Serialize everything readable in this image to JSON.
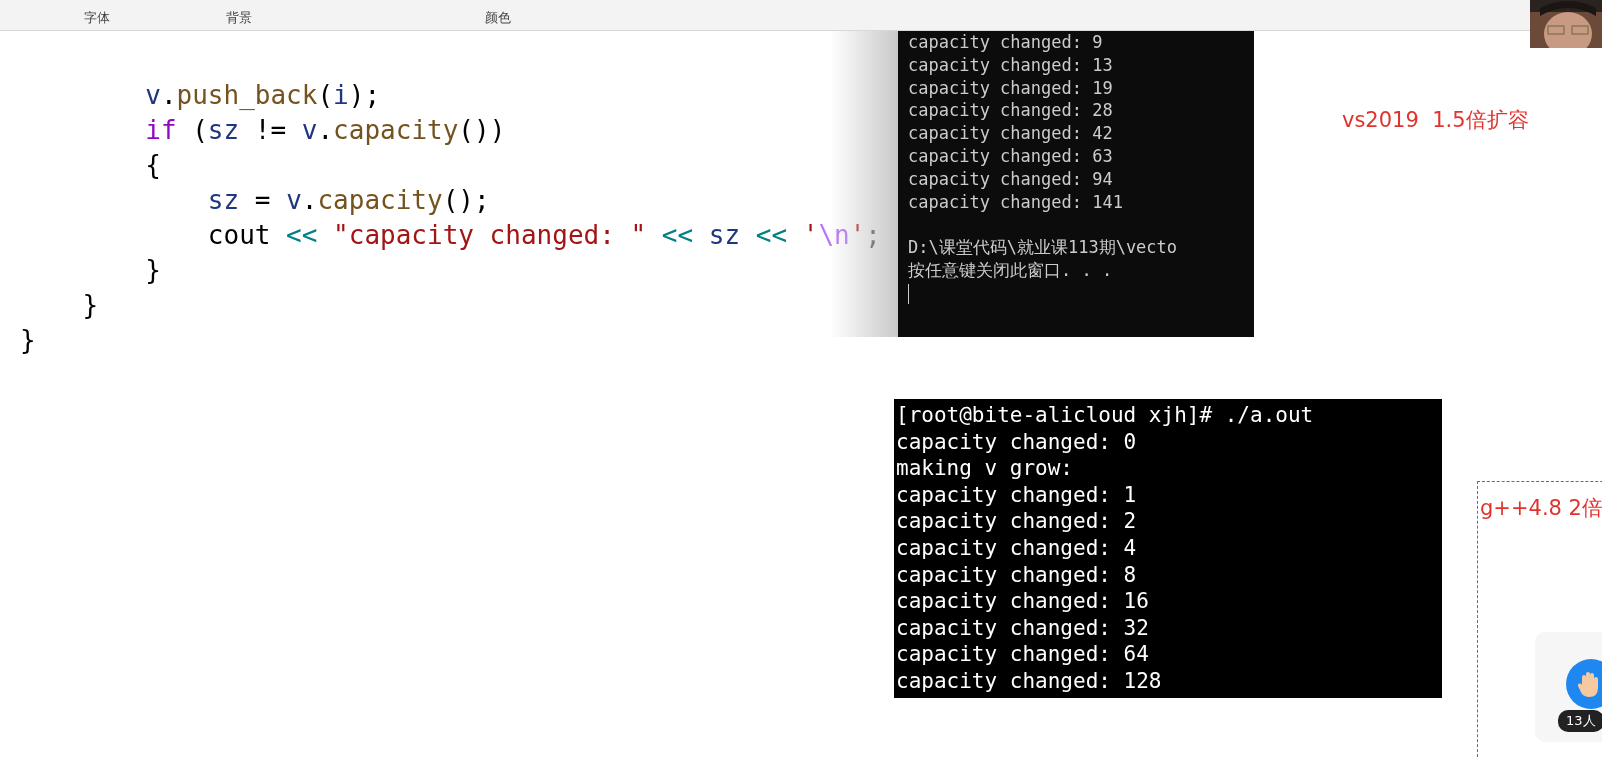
{
  "ribbon": {
    "groups": [
      {
        "label": "字体"
      },
      {
        "label": "背景"
      },
      {
        "label": "颜色"
      }
    ]
  },
  "code": {
    "lines": [
      {
        "tokens": [
          {
            "t": "        v",
            "kind": "var"
          },
          {
            "t": ".",
            "kind": "plain"
          },
          {
            "t": "push_back",
            "kind": "fn"
          },
          {
            "t": "(",
            "kind": "plain"
          },
          {
            "t": "i",
            "kind": "var"
          },
          {
            "t": ");",
            "kind": "plain"
          }
        ]
      },
      {
        "tokens": [
          {
            "t": "        if",
            "kind": "kw"
          },
          {
            "t": " (",
            "kind": "plain"
          },
          {
            "t": "sz",
            "kind": "var"
          },
          {
            "t": " != ",
            "kind": "plain"
          },
          {
            "t": "v",
            "kind": "var"
          },
          {
            "t": ".",
            "kind": "plain"
          },
          {
            "t": "capacity",
            "kind": "fn"
          },
          {
            "t": "())",
            "kind": "plain"
          }
        ]
      },
      {
        "tokens": [
          {
            "t": "        {",
            "kind": "plain"
          }
        ]
      },
      {
        "tokens": [
          {
            "t": "            sz",
            "kind": "var"
          },
          {
            "t": " = ",
            "kind": "plain"
          },
          {
            "t": "v",
            "kind": "var"
          },
          {
            "t": ".",
            "kind": "plain"
          },
          {
            "t": "capacity",
            "kind": "fn"
          },
          {
            "t": "();",
            "kind": "plain"
          }
        ]
      },
      {
        "tokens": [
          {
            "t": "            cout ",
            "kind": "plain"
          },
          {
            "t": "<< ",
            "kind": "op"
          },
          {
            "t": "\"capacity changed: \" ",
            "kind": "str"
          },
          {
            "t": "<< ",
            "kind": "op"
          },
          {
            "t": "sz ",
            "kind": "var"
          },
          {
            "t": "<< ",
            "kind": "op"
          },
          {
            "t": "'",
            "kind": "str"
          },
          {
            "t": "\\n",
            "kind": "esc"
          },
          {
            "t": "'",
            "kind": "str"
          },
          {
            "t": ";",
            "kind": "plain"
          }
        ]
      },
      {
        "tokens": [
          {
            "t": "        }",
            "kind": "plain"
          }
        ]
      },
      {
        "tokens": [
          {
            "t": "    }",
            "kind": "plain"
          }
        ]
      },
      {
        "tokens": [
          {
            "t": "}",
            "kind": "plain"
          }
        ]
      }
    ]
  },
  "console_windows": {
    "output": [
      "capacity changed: 9",
      "capacity changed: 13",
      "capacity changed: 19",
      "capacity changed: 28",
      "capacity changed: 42",
      "capacity changed: 63",
      "capacity changed: 94",
      "capacity changed: 141"
    ],
    "prompt": [
      "D:\\课堂代码\\就业课113期\\vecto",
      "按任意键关闭此窗口. . ."
    ]
  },
  "note_vs": "vs2019  1.5倍扩容",
  "console_linux": {
    "lines": [
      "[root@bite-alicloud xjh]# ./a.out",
      "capacity changed: 0",
      "making v grow:",
      "capacity changed: 1",
      "capacity changed: 2",
      "capacity changed: 4",
      "capacity changed: 8",
      "capacity changed: 16",
      "capacity changed: 32",
      "capacity changed: 64",
      "capacity changed: 128"
    ]
  },
  "note_gpp": "g++4.8 2倍",
  "raise_hand": {
    "count": "13人"
  }
}
